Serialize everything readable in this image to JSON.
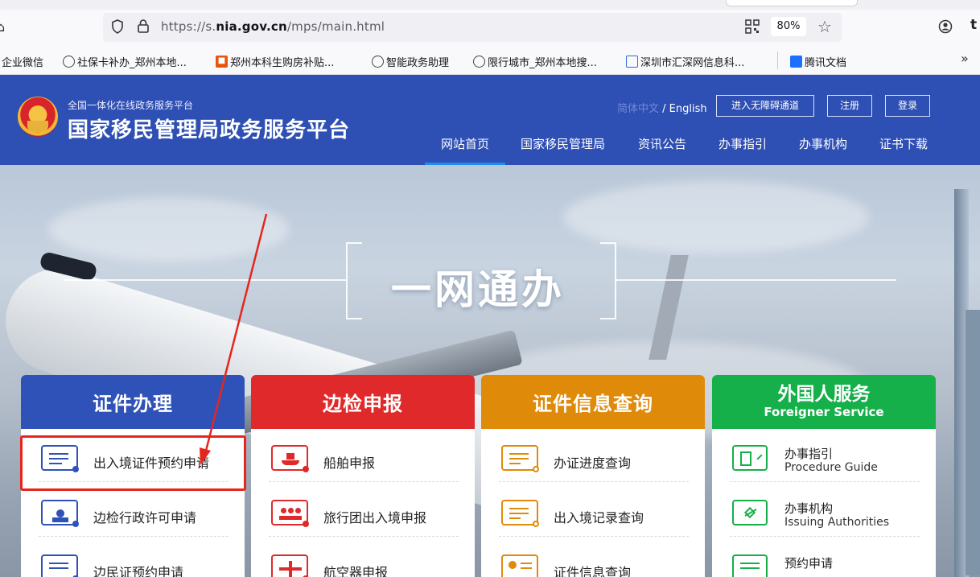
{
  "browser": {
    "url_prefix": "https://s.",
    "url_domain": "nia.gov.cn",
    "url_path": "/mps/main.html",
    "zoom": "80%",
    "ext_letter": "t",
    "bookmarks": [
      "企业微信",
      "社保卡补办_郑州本地...",
      "郑州本科生购房补贴...",
      "智能政务助理",
      "限行城市_郑州本地搜...",
      "深圳市汇深网信息科...",
      "腾讯文档"
    ],
    "more": "»"
  },
  "header": {
    "subtitle": "全国一体化在线政务服务平台",
    "title": "国家移民管理局政务服务平台",
    "lang_cn": "简体中文",
    "lang_en": " / English",
    "accessibility": "进入无障碍通道",
    "register": "注册",
    "login": "登录",
    "nav": [
      "网站首页",
      "国家移民管理局",
      "资讯公告",
      "办事指引",
      "办事机构",
      "证书下载"
    ]
  },
  "hero": {
    "title": "一网通办"
  },
  "cards": [
    {
      "title": "证件办理",
      "color": "#2f52b8",
      "items": [
        "出入境证件预约申请",
        "边检行政许可申请",
        "边民证预约申请"
      ]
    },
    {
      "title": "边检申报",
      "color": "#e0292a",
      "items": [
        "船舶申报",
        "旅行团出入境申报",
        "航空器申报"
      ]
    },
    {
      "title": "证件信息查询",
      "color": "#e08a0a",
      "items": [
        "办证进度查询",
        "出入境记录查询",
        "证件信息查询"
      ]
    },
    {
      "title": "外国人服务",
      "subtitle": "Foreigner Service",
      "color": "#15b04a",
      "items": [
        {
          "cn": "办事指引",
          "en": "Procedure Guide"
        },
        {
          "cn": "办事机构",
          "en": "Issuing Authorities"
        },
        {
          "cn": "预约申请",
          "en": ""
        }
      ]
    }
  ]
}
